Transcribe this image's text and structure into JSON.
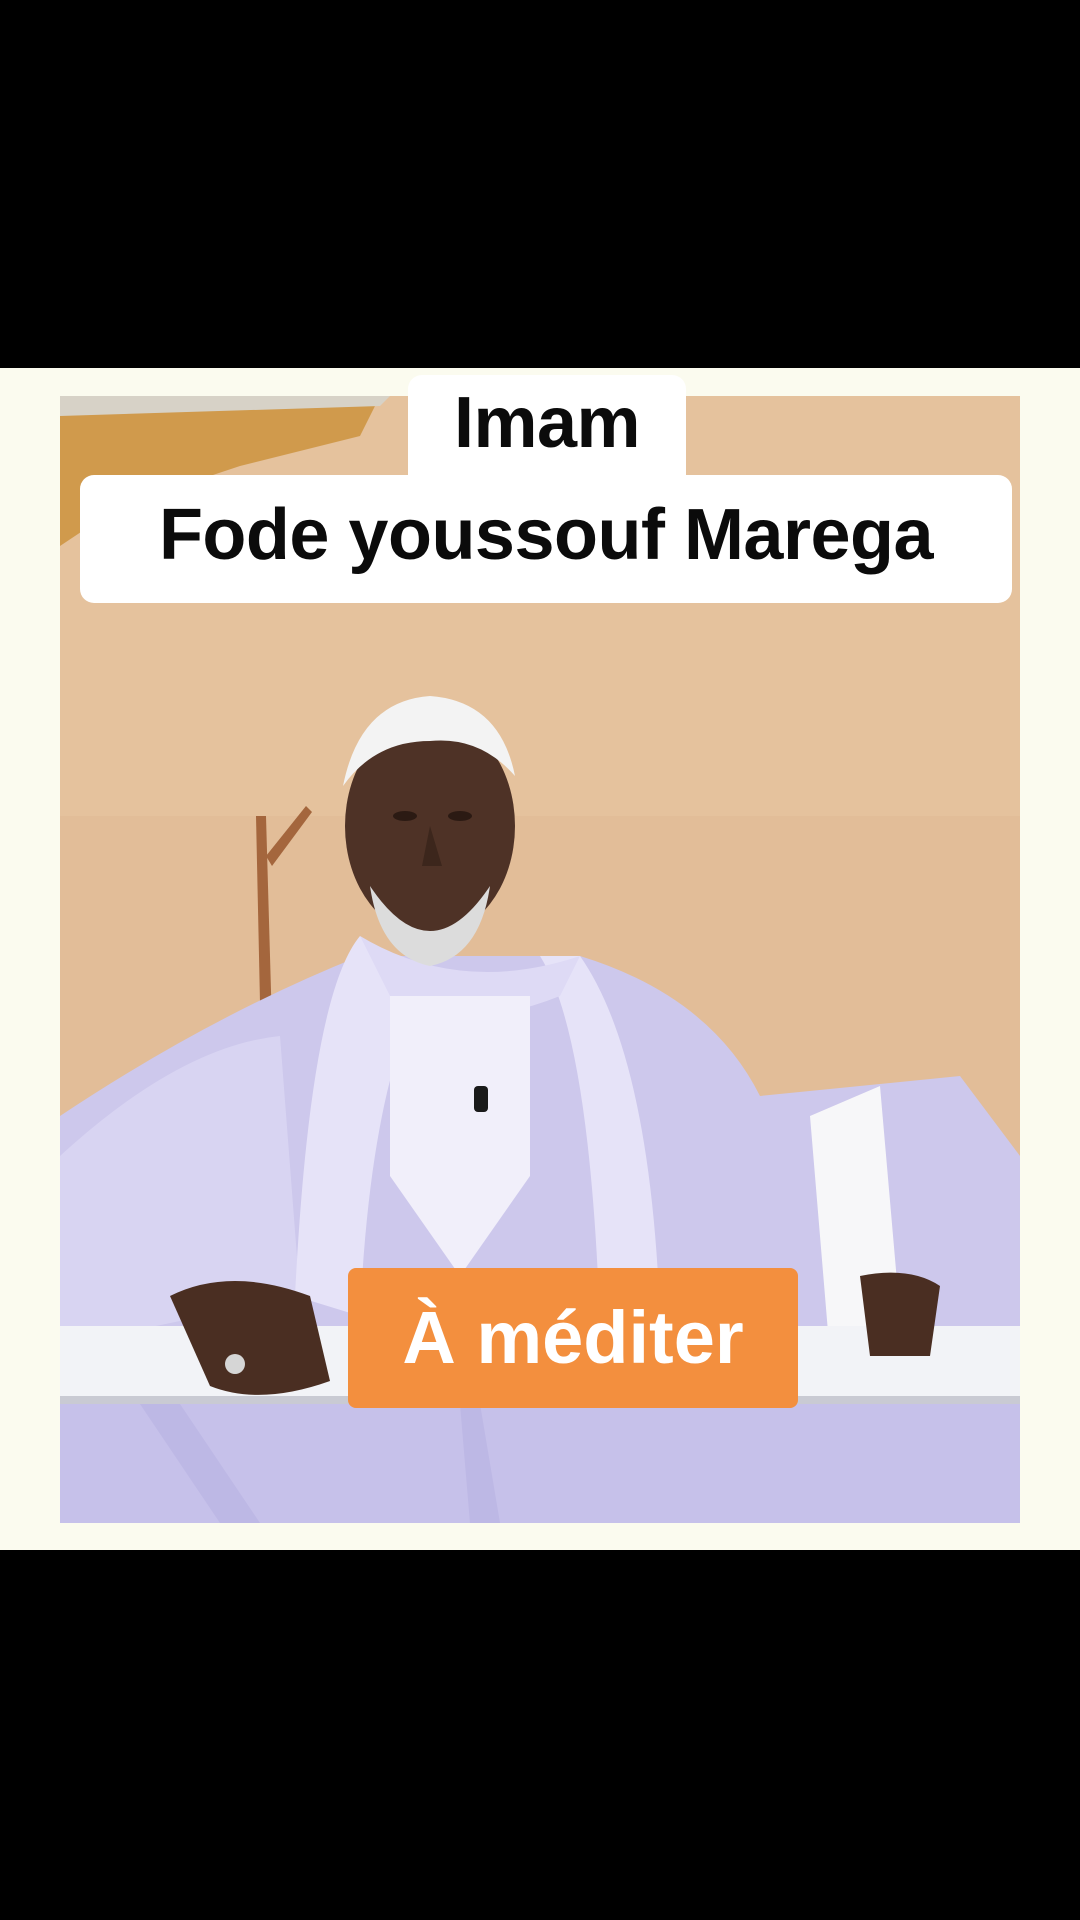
{
  "caption": {
    "line1": "Imam",
    "line2": "Fode youssouf Marega"
  },
  "badge": {
    "label": "À méditer",
    "color": "#f38f3e"
  },
  "colors": {
    "background": "#000000",
    "frame": "#fbfbef",
    "caption_bg": "#ffffff",
    "caption_text": "#0b0b0b"
  }
}
